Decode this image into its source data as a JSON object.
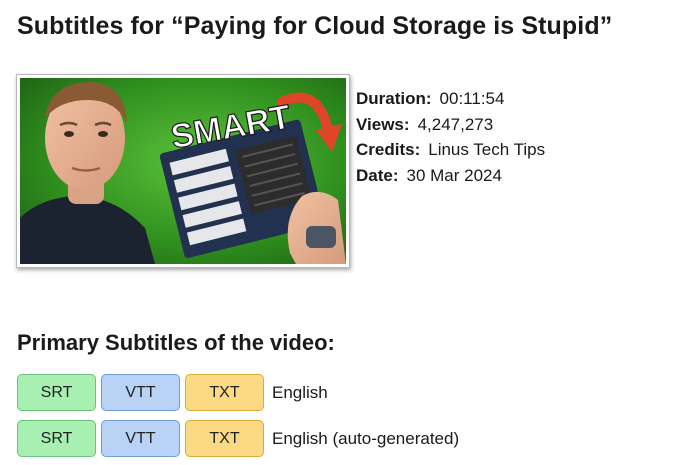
{
  "header": {
    "title": "Subtitles for “Paying for Cloud Storage is Stupid”"
  },
  "thumbnail": {
    "overlay_text": "SMART",
    "colors": {
      "background": "#2f8f1e",
      "arrow": "#e0452a",
      "text": "#ffffff"
    }
  },
  "meta": {
    "duration_label": "Duration:",
    "duration_value": "00:11:54",
    "views_label": "Views:",
    "views_value": "4,247,273",
    "credits_label": "Credits:",
    "credits_value": "Linus Tech Tips",
    "date_label": "Date:",
    "date_value": "30 Mar 2024"
  },
  "subtitles": {
    "section_title": "Primary Subtitles of the video:",
    "tracks": [
      {
        "srt_label": "SRT",
        "vtt_label": "VTT",
        "txt_label": "TXT",
        "language": "English"
      },
      {
        "srt_label": "SRT",
        "vtt_label": "VTT",
        "txt_label": "TXT",
        "language": "English (auto-generated)"
      }
    ],
    "colors": {
      "srt": "#a8f0b2",
      "vtt": "#b8d3f6",
      "txt": "#fcd983"
    }
  }
}
